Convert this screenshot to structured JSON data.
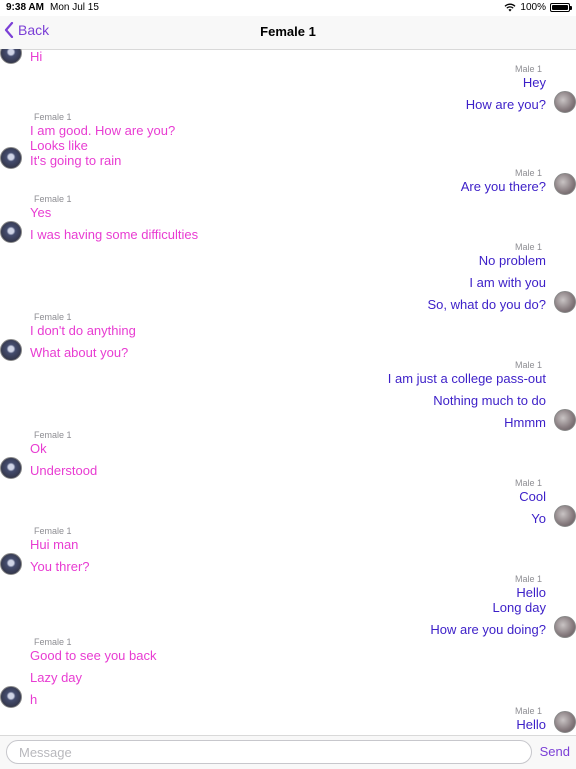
{
  "status": {
    "time": "9:38 AM",
    "date": "Mon Jul 15",
    "battery": "100%"
  },
  "nav": {
    "back_label": "Back",
    "title": "Female 1"
  },
  "messages": {
    "female_sender": "Female 1",
    "male_sender": "Male 1",
    "items": [
      "Hi",
      "Hey",
      "How are you?",
      "I am good. How are you?",
      "Looks like",
      "It's going to rain",
      "Are you there?",
      "Yes",
      "I was having some difficulties",
      "No problem",
      "I am with you",
      "So, what do you do?",
      "I don't do anything",
      "What about you?",
      "I am just a college pass-out",
      "Nothing much to do",
      "Hmmm",
      "Ok",
      "Understood",
      "Cool",
      "Yo",
      "Hui man",
      "You threr?",
      "Hello",
      "Long day",
      "How are you doing?",
      "Good to see you back",
      "Lazy day",
      "h",
      "Hello"
    ]
  },
  "input": {
    "placeholder": "Message",
    "send_label": "Send"
  },
  "colors": {
    "female_text": "#e83cd2",
    "male_text": "#3c1fc8",
    "accent": "#7b3fd6"
  }
}
